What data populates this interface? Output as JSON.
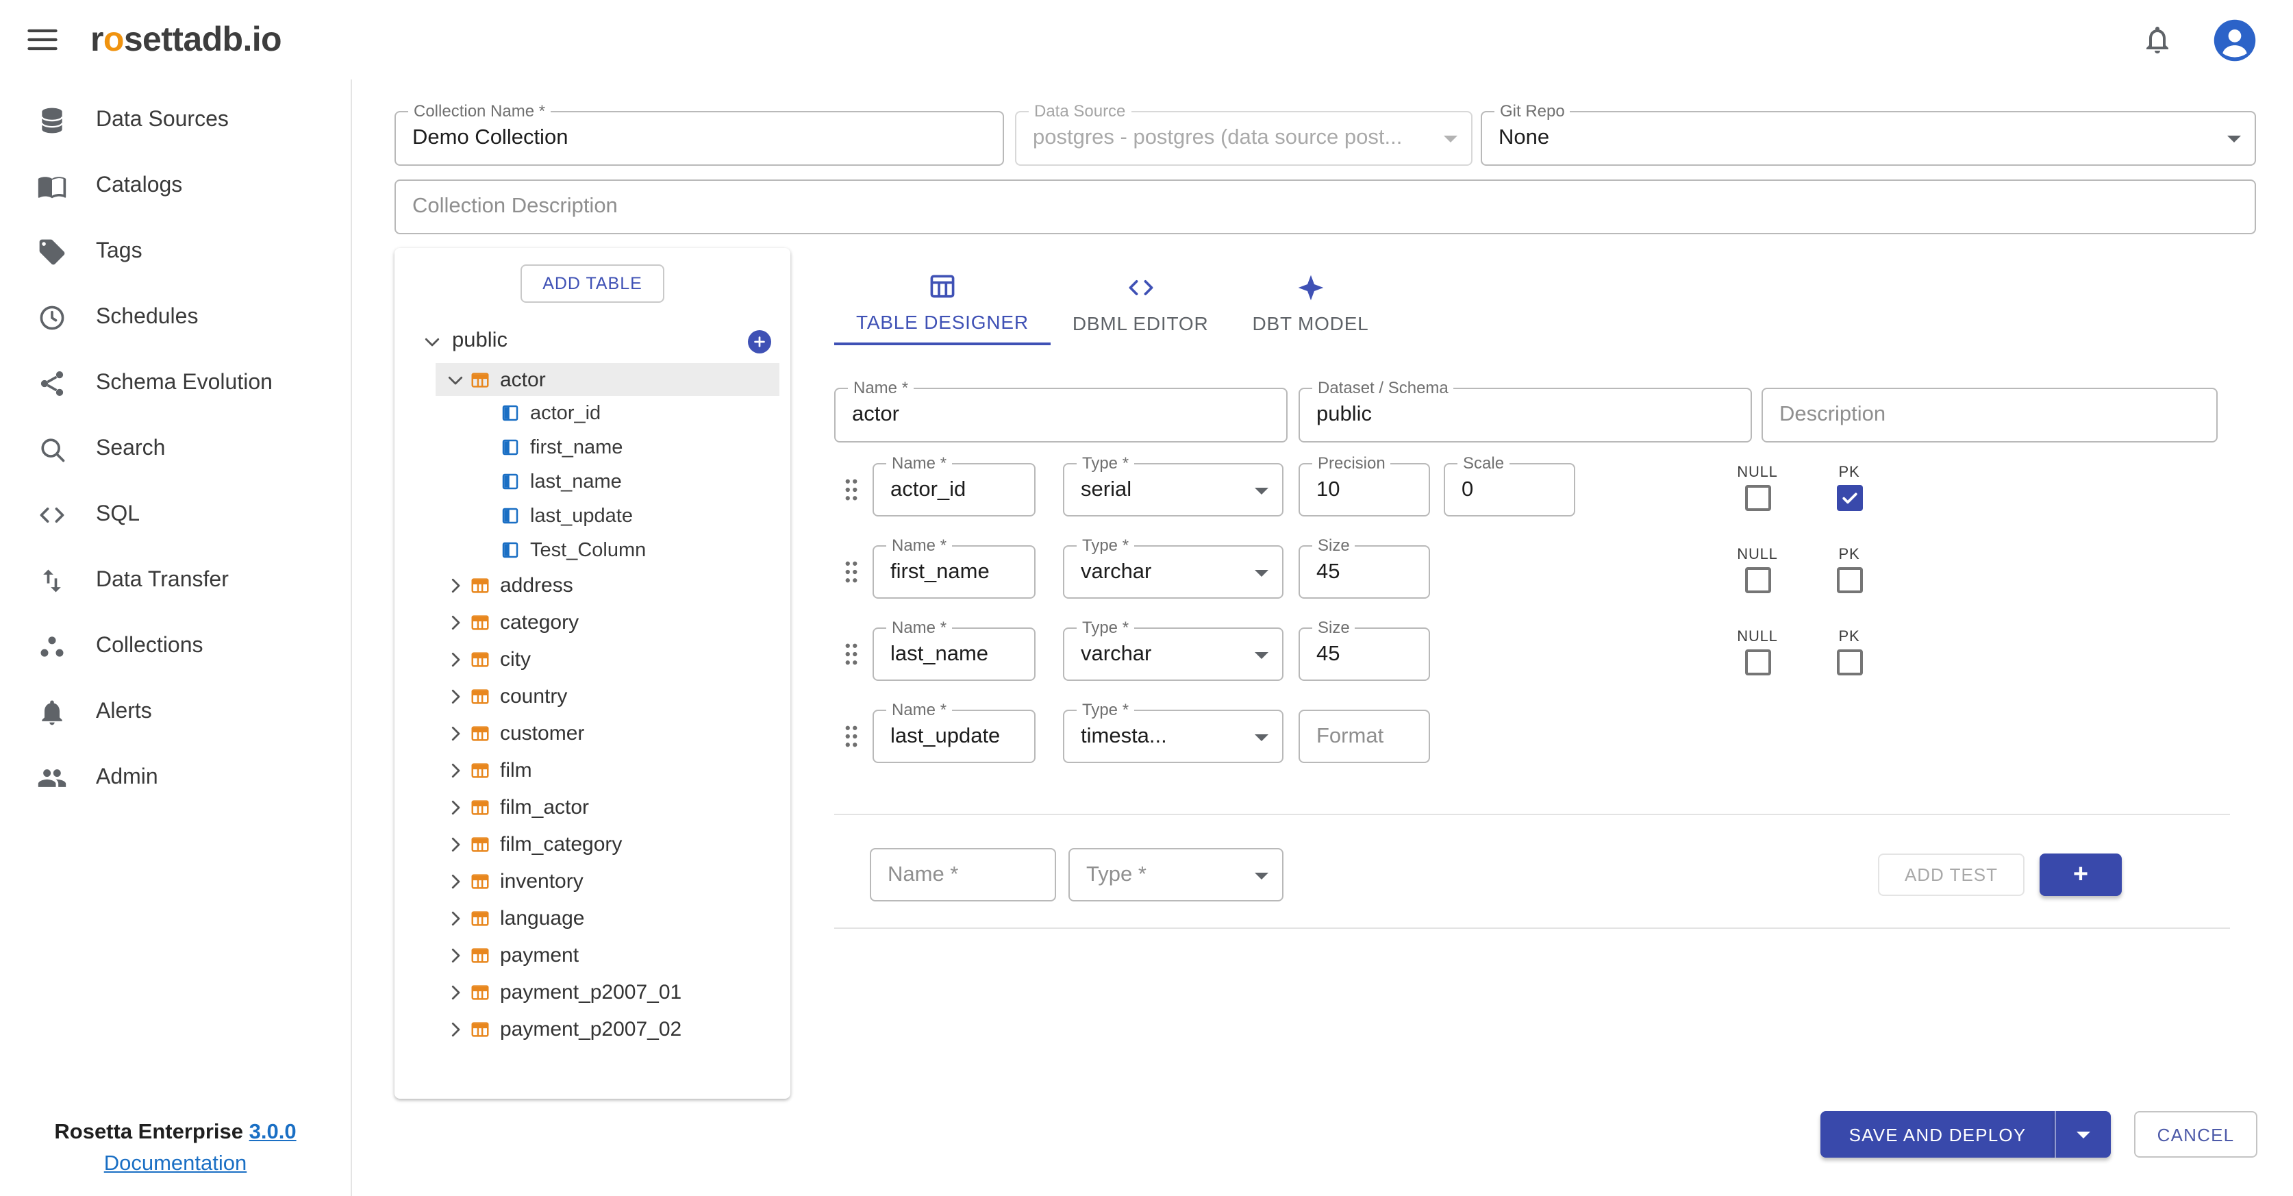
{
  "header": {
    "logo_parts": [
      "r",
      "o",
      "settadb.io"
    ],
    "bell_icon": "notifications-icon",
    "avatar_icon": "account-avatar"
  },
  "sidebar": {
    "items": [
      {
        "label": "Data Sources",
        "icon": "database-icon"
      },
      {
        "label": "Catalogs",
        "icon": "book-icon"
      },
      {
        "label": "Tags",
        "icon": "tag-icon"
      },
      {
        "label": "Schedules",
        "icon": "clock-icon"
      },
      {
        "label": "Schema Evolution",
        "icon": "hub-icon"
      },
      {
        "label": "Search",
        "icon": "search-icon"
      },
      {
        "label": "SQL",
        "icon": "code-icon"
      },
      {
        "label": "Data Transfer",
        "icon": "swap-vertical-icon"
      },
      {
        "label": "Collections",
        "icon": "collections-icon"
      },
      {
        "label": "Alerts",
        "icon": "bell-icon"
      },
      {
        "label": "Admin",
        "icon": "people-icon"
      }
    ],
    "footer": {
      "product": "Rosetta Enterprise",
      "version": "3.0.0",
      "documentation": "Documentation"
    }
  },
  "form": {
    "collection_name": {
      "label": "Collection Name *",
      "value": "Demo Collection"
    },
    "data_source": {
      "label": "Data Source",
      "value": "postgres - postgres (data source post..."
    },
    "git_repo": {
      "label": "Git Repo",
      "value": "None"
    },
    "collection_description": {
      "placeholder": "Collection Description"
    }
  },
  "tree": {
    "add_table": "ADD TABLE",
    "schema": "public",
    "selected_table": "actor",
    "columns": [
      "actor_id",
      "first_name",
      "last_name",
      "last_update",
      "Test_Column"
    ],
    "tables": [
      "address",
      "category",
      "city",
      "country",
      "customer",
      "film",
      "film_actor",
      "film_category",
      "inventory",
      "language",
      "payment",
      "payment_p2007_01",
      "payment_p2007_02"
    ]
  },
  "designer": {
    "tabs": [
      {
        "label": "TABLE DESIGNER",
        "icon": "table-grid-icon",
        "active": true
      },
      {
        "label": "DBML EDITOR",
        "icon": "code-icon",
        "active": false
      },
      {
        "label": "DBT MODEL",
        "icon": "dbt-icon",
        "active": false
      }
    ],
    "table_name": {
      "label": "Name *",
      "value": "actor"
    },
    "dataset": {
      "label": "Dataset / Schema",
      "value": "public"
    },
    "description_placeholder": "Description",
    "labels": {
      "name": "Name *",
      "type": "Type *",
      "precision": "Precision",
      "scale": "Scale",
      "size": "Size",
      "null": "NULL",
      "pk": "PK"
    },
    "rows": [
      {
        "name": "actor_id",
        "type": "serial",
        "precision": "10",
        "scale": "0",
        "null": false,
        "pk": true
      },
      {
        "name": "first_name",
        "type": "varchar",
        "size": "45",
        "null": false,
        "pk": false
      },
      {
        "name": "last_name",
        "type": "varchar",
        "size": "45",
        "null": false,
        "pk": false
      },
      {
        "name": "last_update",
        "type": "timesta...",
        "format_placeholder": "Format"
      }
    ],
    "tests": {
      "name_placeholder": "Name *",
      "type_placeholder": "Type *",
      "add_test": "ADD TEST",
      "add": "+"
    }
  },
  "actions": {
    "save": "SAVE AND DEPLOY",
    "cancel": "CANCEL"
  },
  "colors": {
    "primary": "#3f51b5",
    "table_icon": "#e8871e",
    "column_icon": "#1a6fc4"
  }
}
